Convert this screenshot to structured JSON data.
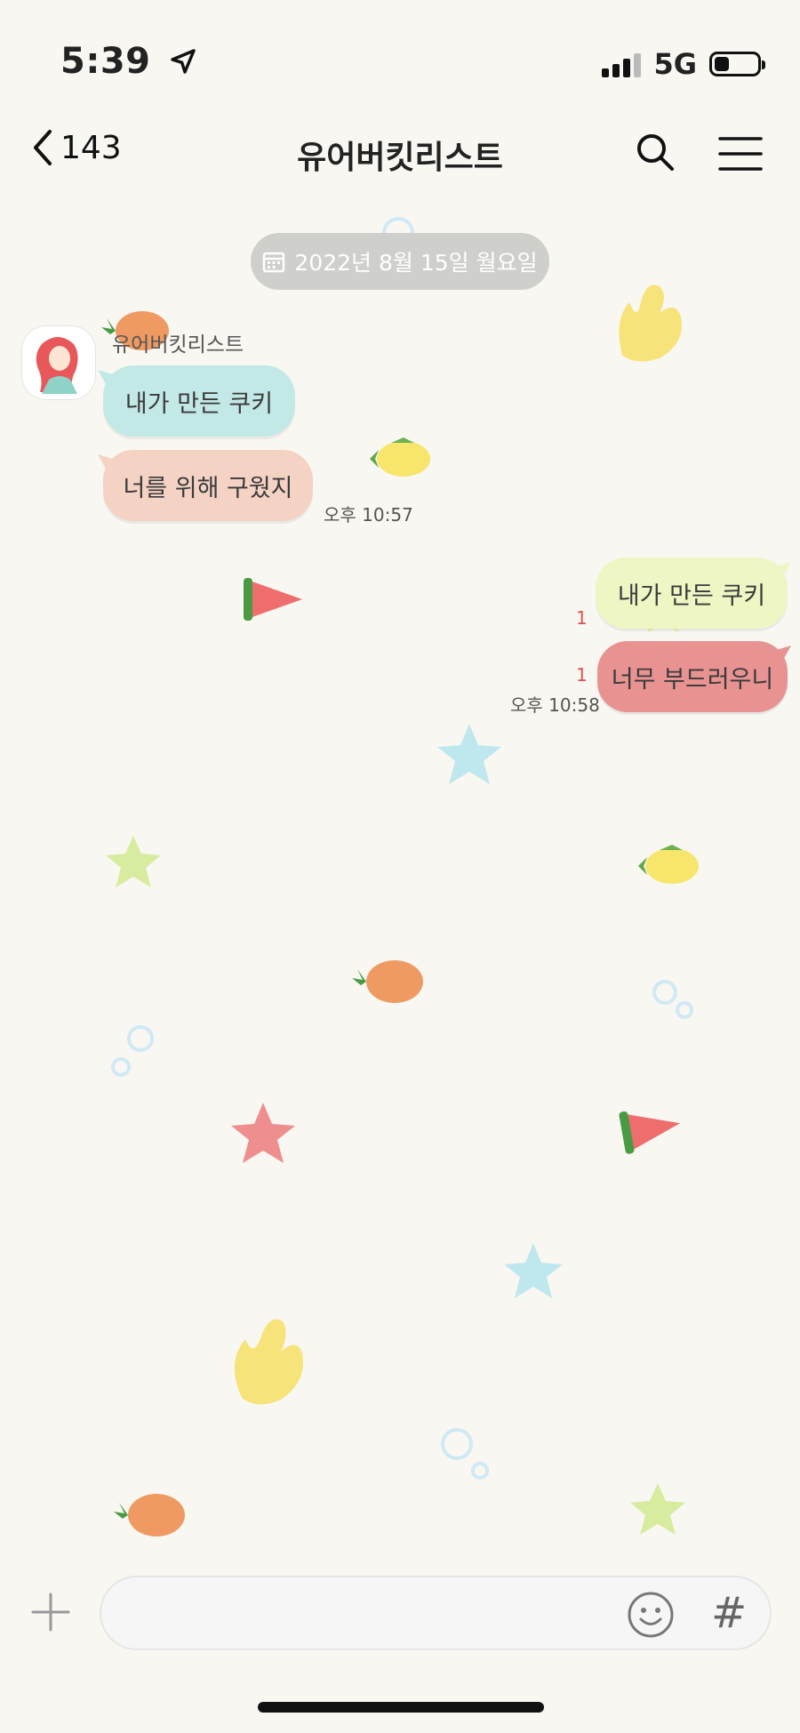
{
  "status_bar": {
    "time": "5:39",
    "network": "5G"
  },
  "header": {
    "back_count": "143",
    "title": "유어버킷리스트"
  },
  "date_divider": {
    "label": "2022년 8월 15일 월요일"
  },
  "received": {
    "sender": "유어버킷리스트",
    "messages": [
      "내가 만든 쿠키",
      "너를 위해 구웠지"
    ],
    "time": "오후 10:57"
  },
  "sent": {
    "messages": [
      {
        "text": "내가 만든 쿠키",
        "unread": "1"
      },
      {
        "text": "너무 부드러우니",
        "unread": "1"
      }
    ],
    "time": "오후 10:58"
  },
  "input": {
    "value": "",
    "hash_label": "#"
  },
  "colors": {
    "background": "#f9f7f2",
    "bubble_mint": "#c3e9e6",
    "bubble_peach": "#f4d2c4",
    "bubble_lime": "#eef6c4",
    "bubble_red": "#e89292",
    "unread": "#d9534f"
  },
  "icons": [
    "location-arrow-icon",
    "signal-icon",
    "battery-icon",
    "back-chevron-icon",
    "search-icon",
    "menu-icon",
    "calendar-icon",
    "plus-icon",
    "emoji-icon"
  ]
}
